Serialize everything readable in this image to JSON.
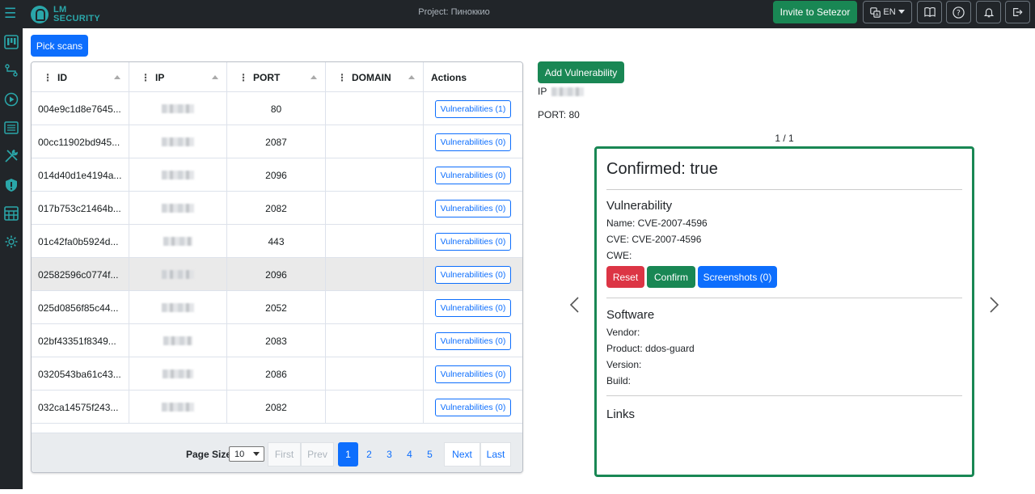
{
  "app": {
    "logo_line1": "LM",
    "logo_line2": "SECURITY",
    "project_title": "Project: Пиноккио",
    "invite_label": "Invite to Setezor",
    "lang_label": "EN"
  },
  "colors": {
    "accent": "#2aa6a9",
    "primary": "#0d6efd",
    "success": "#198754",
    "danger": "#dc3545",
    "topbar": "#212529"
  },
  "topbar_icons": [
    "book-icon",
    "help-icon",
    "bell-icon",
    "logout-icon"
  ],
  "sidebar_icons": [
    "board-icon",
    "network-icon",
    "play-icon",
    "list-icon",
    "tools-icon",
    "shield-icon",
    "table-icon",
    "gear-icon"
  ],
  "pick_scans_label": "Pick scans",
  "grid": {
    "columns": [
      "ID",
      "IP",
      "PORT",
      "DOMAIN",
      "Actions"
    ],
    "rows": [
      {
        "id": "004e9c1d8e7645...",
        "port": "80",
        "domain": "",
        "action": "Vulnerabilities (1)"
      },
      {
        "id": "00cc11902bd945...",
        "port": "2087",
        "domain": "",
        "action": "Vulnerabilities (0)"
      },
      {
        "id": "014d40d1e4194a...",
        "port": "2096",
        "domain": "",
        "action": "Vulnerabilities (0)"
      },
      {
        "id": "017b753c21464b...",
        "port": "2082",
        "domain": "",
        "action": "Vulnerabilities (0)"
      },
      {
        "id": "01c42fa0b5924d...",
        "port": "443",
        "domain": "",
        "action": "Vulnerabilities (0)"
      },
      {
        "id": "02582596c0774f...",
        "port": "2096",
        "domain": "",
        "action": "Vulnerabilities (0)"
      },
      {
        "id": "025d0856f85c44...",
        "port": "2052",
        "domain": "",
        "action": "Vulnerabilities (0)"
      },
      {
        "id": "02bf43351f8349...",
        "port": "2083",
        "domain": "",
        "action": "Vulnerabilities (0)"
      },
      {
        "id": "0320543ba61c43...",
        "port": "2086",
        "domain": "",
        "action": "Vulnerabilities (0)"
      },
      {
        "id": "032ca14575f243...",
        "port": "2082",
        "domain": "",
        "action": "Vulnerabilities (0)"
      }
    ],
    "footer": {
      "page_size_label": "Page Size",
      "page_size_value": "10",
      "first": "First",
      "prev": "Prev",
      "pages": [
        "1",
        "2",
        "3",
        "4",
        "5"
      ],
      "current_page": "1",
      "next": "Next",
      "last": "Last"
    }
  },
  "detail": {
    "add_label": "Add Vulnerability",
    "ip_label": "IP",
    "port_line": "PORT: 80",
    "counter": "1 / 1",
    "confirmed": "Confirmed: true",
    "vuln_heading": "Vulnerability",
    "name_line": "Name: CVE-2007-4596",
    "cve_line": "CVE: CVE-2007-4596",
    "cwe_line": "CWE:",
    "reset_label": "Reset",
    "confirm_label": "Confirm",
    "screens_label": "Screenshots (0)",
    "software_heading": "Software",
    "vendor_line": "Vendor:",
    "product_line": "Product: ddos-guard",
    "version_line": "Version:",
    "build_line": "Build:",
    "links_heading": "Links"
  }
}
